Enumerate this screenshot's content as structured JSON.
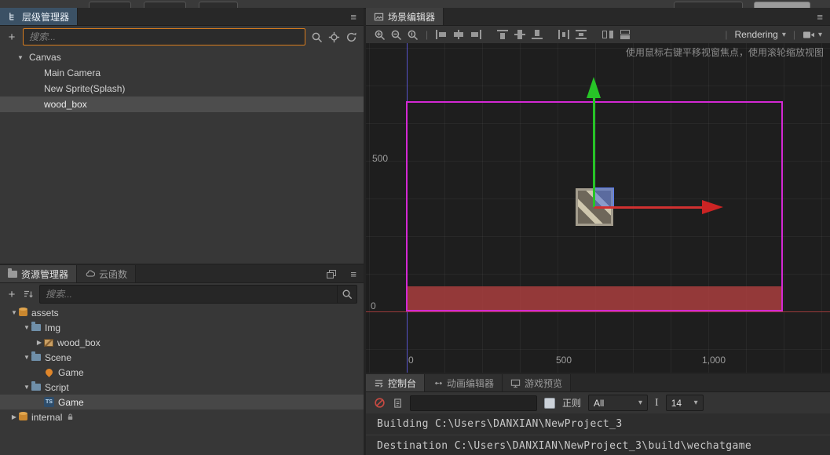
{
  "icons": {
    "hamburger": "≡",
    "plus": "+",
    "caret_down": "▾",
    "tri_down": "▼",
    "tri_right": "▶",
    "sep": "|",
    "ts_label": "TS",
    "font_size_glyph": "I"
  },
  "hierarchy": {
    "tab_label": "层级管理器",
    "search_placeholder": "搜索...",
    "tree": [
      {
        "label": "Canvas"
      },
      {
        "label": "Main Camera"
      },
      {
        "label": "New Sprite(Splash)"
      },
      {
        "label": "wood_box"
      }
    ]
  },
  "assets": {
    "tab_assets": "资源管理器",
    "tab_cloud": "云函数",
    "search_placeholder": "搜索...",
    "tree": [
      {
        "label": "assets"
      },
      {
        "label": "Img"
      },
      {
        "label": "wood_box"
      },
      {
        "label": "Scene"
      },
      {
        "label": "Game"
      },
      {
        "label": "Script"
      },
      {
        "label": "Game"
      },
      {
        "label": "internal"
      }
    ]
  },
  "scene": {
    "tab_label": "场景编辑器",
    "rendering_label": "Rendering",
    "hint": "使用鼠标右键平移视窗焦点，使用滚轮缩放视图",
    "axis_left": [
      "500",
      "0"
    ],
    "axis_bottom": [
      "0",
      "500",
      "1,000"
    ],
    "toolbar_icons": [
      "zoom-in",
      "zoom-out",
      "zoom-reset",
      "align-left",
      "align-center-horizontal",
      "align-right",
      "align-top",
      "align-middle",
      "align-bottom",
      "distribute-horizontal",
      "distribute-vertical",
      "flip-horizontal",
      "flip-vertical"
    ]
  },
  "console": {
    "tab_console": "控制台",
    "tab_anim": "动画编辑器",
    "tab_preview": "游戏预览",
    "regex_label": "正则",
    "filter_value": "All",
    "font_size_value": "14",
    "logs": [
      "Building C:\\Users\\DANXIAN\\NewProject_3",
      "Destination C:\\Users\\DANXIAN\\NewProject_3\\build\\wechatgame"
    ]
  }
}
